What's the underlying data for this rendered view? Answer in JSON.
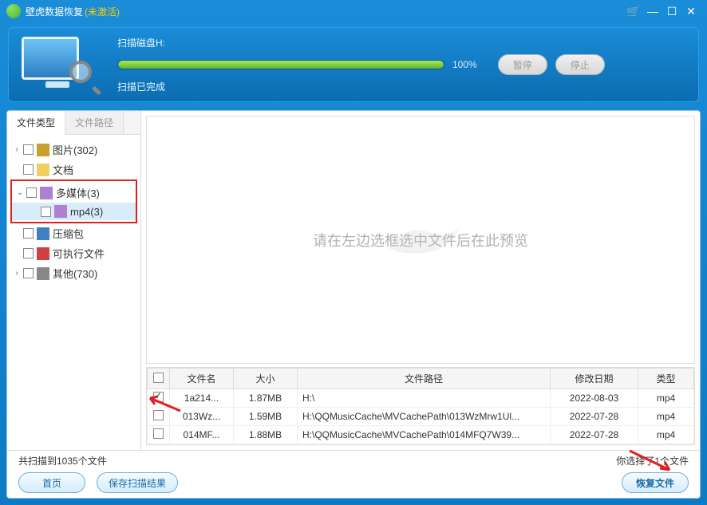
{
  "titlebar": {
    "app_name": "壁虎数据恢复",
    "not_activated": "(未激活)"
  },
  "scan": {
    "scanning_label": "扫描磁盘H:",
    "percent_text": "100%",
    "percent_value": 100,
    "done_label": "扫描已完成",
    "pause_label": "暂停",
    "stop_label": "停止"
  },
  "tabs": {
    "file_type": "文件类型",
    "file_path": "文件路径"
  },
  "tree": {
    "pictures": "图片(302)",
    "documents": "文档",
    "multimedia": "多媒体(3)",
    "mp4": "mp4(3)",
    "archive": "压缩包",
    "executable": "可执行文件",
    "other": "其他(730)"
  },
  "preview": {
    "placeholder": "请在左边选框选中文件后在此预览"
  },
  "table": {
    "headers": {
      "filename": "文件名",
      "size": "大小",
      "path": "文件路径",
      "mtime": "修改日期",
      "type": "类型"
    },
    "rows": [
      {
        "checked": true,
        "name": "1a214...",
        "size": "1.87MB",
        "path": "H:\\",
        "mtime": "2022-08-03",
        "type": "mp4"
      },
      {
        "checked": false,
        "name": "013Wz...",
        "size": "1.59MB",
        "path": "H:\\QQMusicCache\\MVCachePath\\013WzMrw1Ul...",
        "mtime": "2022-07-28",
        "type": "mp4"
      },
      {
        "checked": false,
        "name": "014MF...",
        "size": "1.88MB",
        "path": "H:\\QQMusicCache\\MVCachePath\\014MFQ7W39...",
        "mtime": "2022-07-28",
        "type": "mp4"
      }
    ]
  },
  "footer": {
    "scanned_count": "共扫描到1035个文件",
    "selected_count": "你选择了1个文件",
    "home": "首页",
    "save_results": "保存扫描结果",
    "recover": "恢复文件"
  }
}
